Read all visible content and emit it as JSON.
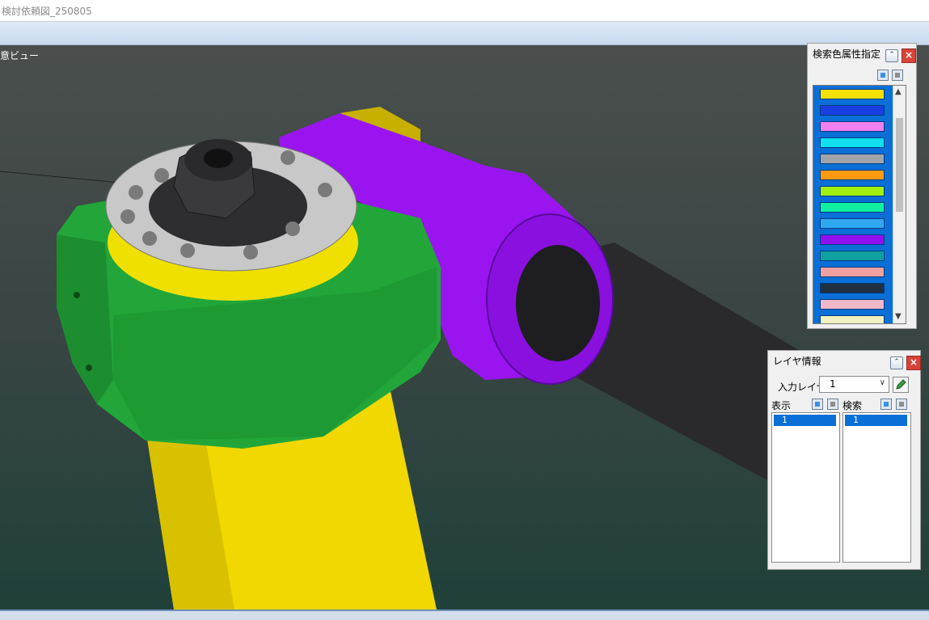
{
  "window": {
    "title": "検討依頼図_250805"
  },
  "viewport": {
    "label": "意ビュー"
  },
  "color_panel": {
    "title": "検索色属性指定",
    "colors": [
      "#f5e000",
      "#1a3fe0",
      "#f080f0",
      "#10e0f0",
      "#a0a4a8",
      "#ff9a10",
      "#a0f010",
      "#10f0a0",
      "#30a8f0",
      "#9010f0",
      "#10a0a0",
      "#f0a0a0",
      "#203040",
      "#f0b8c8",
      "#f0f0c0"
    ]
  },
  "layer_panel": {
    "title": "レイヤ情報",
    "input_layer_label": "入力レイヤ",
    "input_layer_value": "1",
    "display_label": "表示",
    "search_label": "検索",
    "display_items": [
      "1"
    ],
    "search_items": [
      "1"
    ]
  }
}
